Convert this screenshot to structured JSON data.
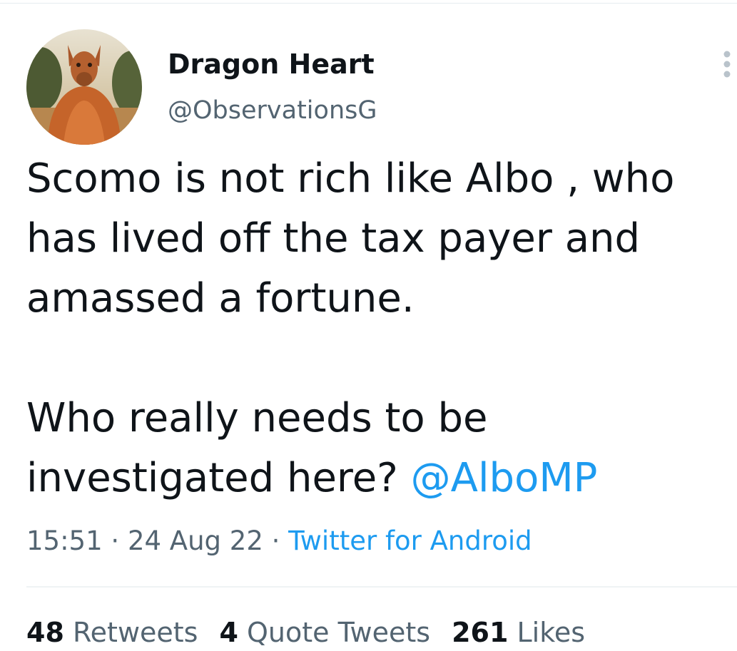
{
  "author": {
    "display_name": "Dragon Heart",
    "handle": "@ObservationsG",
    "avatar_icon": "kangaroo-avatar"
  },
  "menu": {
    "icon": "more-vertical-icon"
  },
  "tweet": {
    "line1": "Scomo is not rich like Albo , who",
    "line2": "has lived off the tax payer and",
    "line3": "amassed a fortune.",
    "line4": "Who really needs to be",
    "line5_text": "investigated here? ",
    "mention": "@AlboMP"
  },
  "meta": {
    "time": "15:51",
    "separator": " · ",
    "date": "24 Aug 22",
    "source": "Twitter for Android"
  },
  "stats": {
    "retweets_count": "48",
    "retweets_label": " Retweets",
    "quotes_count": "4",
    "quotes_label": " Quote Tweets",
    "likes_count": "261",
    "likes_label": " Likes"
  },
  "colors": {
    "text": "#0f1419",
    "secondary": "#536471",
    "accent": "#1d9bf0",
    "divider": "#eff3f4"
  }
}
